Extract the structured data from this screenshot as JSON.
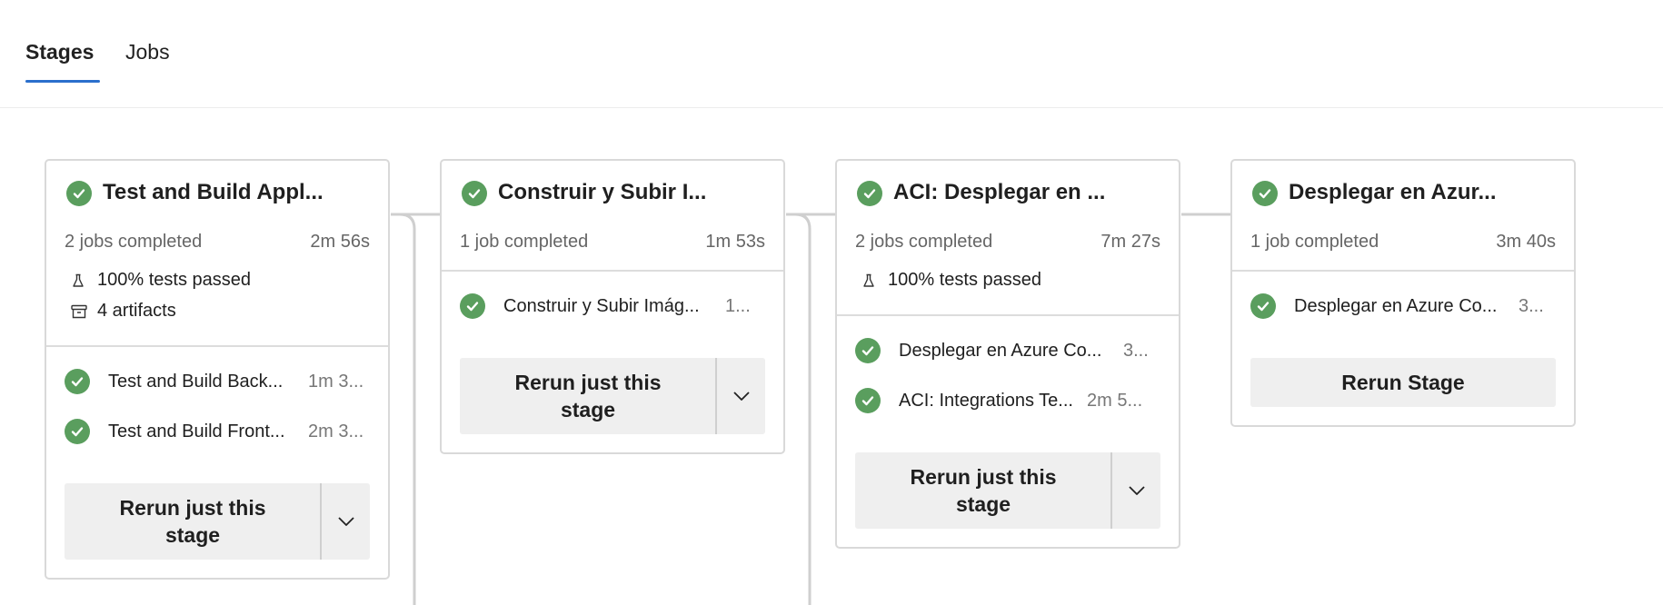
{
  "tabs": [
    {
      "label": "Stages",
      "active": true
    },
    {
      "label": "Jobs",
      "active": false
    }
  ],
  "colors": {
    "success": "#5a9e5e",
    "accent": "#2b6fcc"
  },
  "stages": [
    {
      "title": "Test and Build Appl...",
      "summary": "2 jobs completed",
      "duration": "2m 56s",
      "tests": "100% tests passed",
      "artifacts": "4 artifacts",
      "jobs": [
        {
          "name": "Test and Build Back...",
          "duration": "1m 3..."
        },
        {
          "name": "Test and Build Front...",
          "duration": "2m 3..."
        }
      ],
      "button": "Rerun just this stage"
    },
    {
      "title": "Construir y Subir I...",
      "summary": "1 job completed",
      "duration": "1m 53s",
      "jobs": [
        {
          "name": "Construir y Subir Imág...",
          "duration": "1..."
        }
      ],
      "button": "Rerun just this stage"
    },
    {
      "title": "ACI: Desplegar en ...",
      "summary": "2 jobs completed",
      "duration": "7m 27s",
      "tests": "100% tests passed",
      "jobs": [
        {
          "name": "Desplegar en Azure Co...",
          "duration": "3..."
        },
        {
          "name": "ACI: Integrations Te...",
          "duration": "2m 5..."
        }
      ],
      "button": "Rerun just this stage"
    },
    {
      "title": "Desplegar en Azur...",
      "summary": "1 job completed",
      "duration": "3m 40s",
      "jobs": [
        {
          "name": "Desplegar en Azure Co...",
          "duration": "3..."
        }
      ],
      "button": "Rerun Stage"
    }
  ]
}
